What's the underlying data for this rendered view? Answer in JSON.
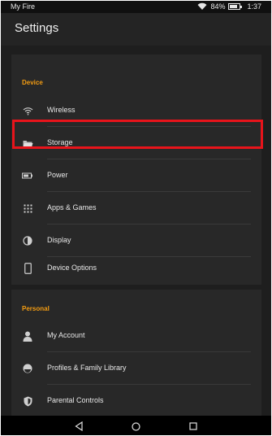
{
  "status_bar": {
    "carrier": "My Fire",
    "battery_percent": "84%",
    "time": "1:37"
  },
  "header": {
    "title": "Settings"
  },
  "device_section": {
    "title": "Device",
    "items": [
      {
        "label": "Wireless",
        "icon": "wifi-icon"
      },
      {
        "label": "Storage",
        "icon": "folder-icon"
      },
      {
        "label": "Power",
        "icon": "battery-icon"
      },
      {
        "label": "Apps & Games",
        "icon": "apps-grid-icon"
      },
      {
        "label": "Display",
        "icon": "contrast-icon"
      },
      {
        "label": "Device Options",
        "icon": "tablet-icon"
      }
    ]
  },
  "personal_section": {
    "title": "Personal",
    "items": [
      {
        "label": "My Account",
        "icon": "person-icon"
      },
      {
        "label": "Profiles & Family Library",
        "icon": "profiles-icon"
      },
      {
        "label": "Parental Controls",
        "icon": "shield-icon"
      }
    ]
  },
  "highlight": {
    "target": "Storage",
    "color": "#e8141b"
  },
  "colors": {
    "accent": "#f39c12",
    "background": "#1c1c1c",
    "card": "#282828"
  },
  "nav_bar": {
    "buttons": [
      "back-icon",
      "home-icon",
      "recents-icon"
    ]
  }
}
